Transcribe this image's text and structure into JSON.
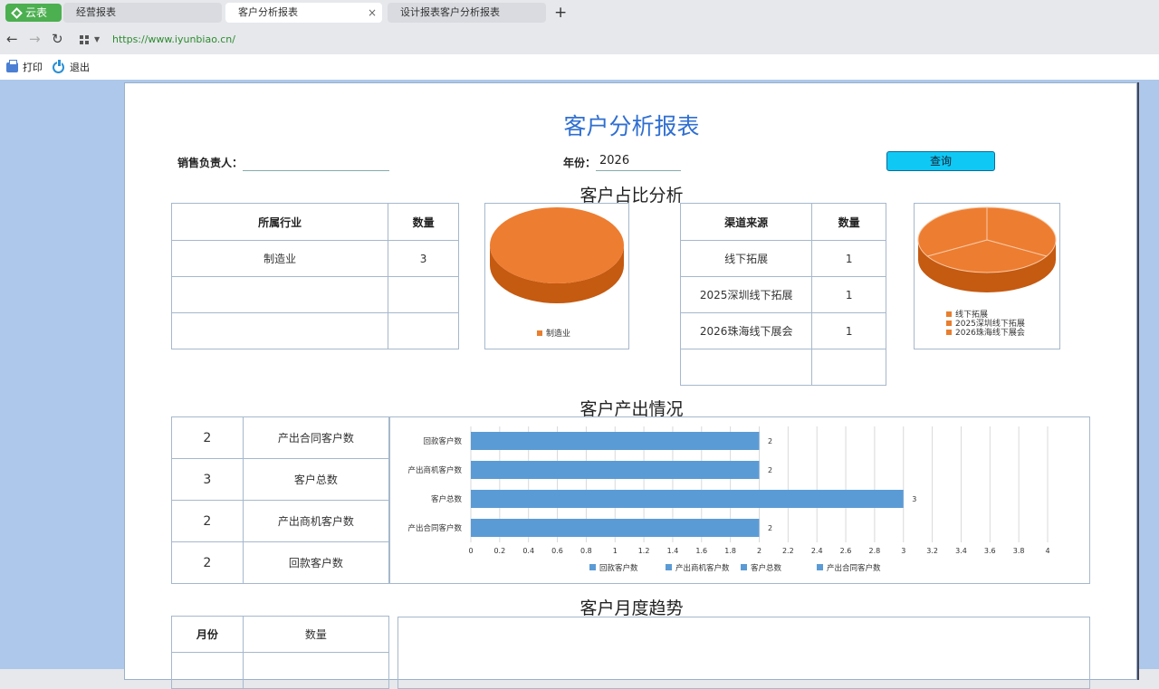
{
  "tabs": {
    "brand": "云表",
    "items": [
      {
        "label": "经营报表"
      },
      {
        "label": "客户分析报表"
      },
      {
        "label": "设计报表客户分析报表"
      }
    ],
    "close_glyph": "×",
    "new_tab_glyph": "+"
  },
  "address": {
    "url": "https://www.iyunbiao.cn/"
  },
  "toolbar": {
    "print_label": "打印",
    "exit_label": "退出"
  },
  "report": {
    "title": "客户分析报表",
    "sales_label": "销售负责人：",
    "sales_value": "",
    "year_label": "年份：",
    "year_value": "2026",
    "query_label": "查询"
  },
  "share_section": {
    "title": "客户占比分析",
    "industry_table": {
      "headers": [
        "所属行业",
        "数量"
      ],
      "rows": [
        [
          "制造业",
          "3"
        ],
        [
          "",
          ""
        ],
        [
          "",
          ""
        ]
      ]
    },
    "channel_table": {
      "headers": [
        "渠道来源",
        "数量"
      ],
      "rows": [
        [
          "线下拓展",
          "1"
        ],
        [
          "2025深圳线下拓展",
          "1"
        ],
        [
          "2026珠海线下展会",
          "1"
        ],
        [
          "",
          ""
        ]
      ]
    }
  },
  "output_section": {
    "title": "客户产出情况",
    "table": [
      {
        "value": "2",
        "label": "产出合同客户数"
      },
      {
        "value": "3",
        "label": "客户总数"
      },
      {
        "value": "2",
        "label": "产出商机客户数"
      },
      {
        "value": "2",
        "label": "回款客户数"
      }
    ]
  },
  "monthly_section": {
    "title": "客户月度趋势",
    "headers": [
      "月份",
      "数量"
    ]
  },
  "colors": {
    "pie_top": "#ed7d31",
    "pie_side": "#c55a11",
    "bar": "#5b9bd5",
    "title_blue": "#2f6fd1",
    "query_button": "#10c8f4"
  },
  "chart_data": [
    {
      "type": "pie",
      "categories": [
        "制造业"
      ],
      "values": [
        3
      ],
      "legend": [
        "制造业"
      ]
    },
    {
      "type": "pie",
      "categories": [
        "线下拓展",
        "2025深圳线下拓展",
        "2026珠海线下展会"
      ],
      "values": [
        1,
        1,
        1
      ],
      "legend": [
        "线下拓展",
        "2025深圳线下拓展",
        "2026珠海线下展会"
      ]
    },
    {
      "type": "bar",
      "orientation": "horizontal",
      "categories": [
        "回款客户数",
        "产出商机客户数",
        "客户总数",
        "产出合同客户数"
      ],
      "values": [
        2,
        2,
        3,
        2
      ],
      "xlim": [
        0,
        4
      ],
      "xticks": [
        "0",
        "0.2",
        "0.4",
        "0.6",
        "0.8",
        "1",
        "1.2",
        "1.4",
        "1.6",
        "1.8",
        "2",
        "2.2",
        "2.4",
        "2.6",
        "2.8",
        "3",
        "3.2",
        "3.4",
        "3.6",
        "3.8",
        "4"
      ],
      "legend": [
        "回款客户数",
        "产出商机客户数",
        "客户总数",
        "产出合同客户数"
      ],
      "grid": true
    }
  ]
}
